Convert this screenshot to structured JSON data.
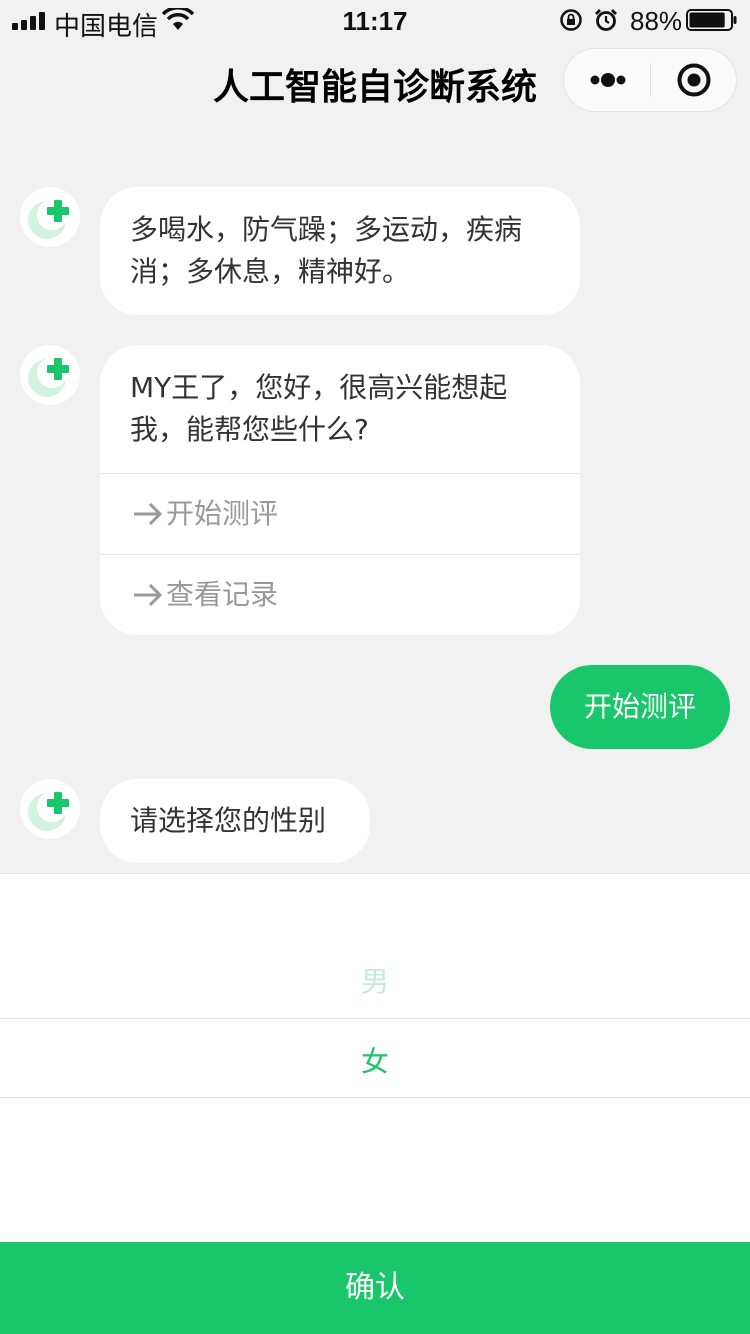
{
  "status_bar": {
    "carrier": "中国电信",
    "time": "11:17",
    "battery_percent": "88%",
    "battery_level": 0.88,
    "icons": [
      "signal-icon",
      "wifi-icon",
      "orientation-lock-icon",
      "alarm-icon",
      "battery-icon"
    ]
  },
  "nav": {
    "title": "人工智能自诊断系统",
    "icons": [
      "more-icon",
      "close-target-icon"
    ]
  },
  "chat": {
    "bot_avatar_icon": "medical-cross-logo-icon",
    "messages": [
      {
        "from": "bot",
        "text": "多喝水，防气躁；多运动，疾病消；多休息，精神好。"
      },
      {
        "from": "bot",
        "text": "MY王了，您好，很高兴能想起我，能帮您些什么?",
        "options": [
          "开始测评",
          "查看记录"
        ]
      },
      {
        "from": "user",
        "text": "开始测评"
      },
      {
        "from": "bot",
        "text": "请选择您的性别"
      }
    ]
  },
  "picker": {
    "options": [
      "男",
      "女"
    ],
    "selected": "女"
  },
  "confirm_label": "确认",
  "colors": {
    "accent": "#19c66b",
    "background": "#f1f1f1",
    "bubble": "#ffffff",
    "option_text": "#999999"
  }
}
